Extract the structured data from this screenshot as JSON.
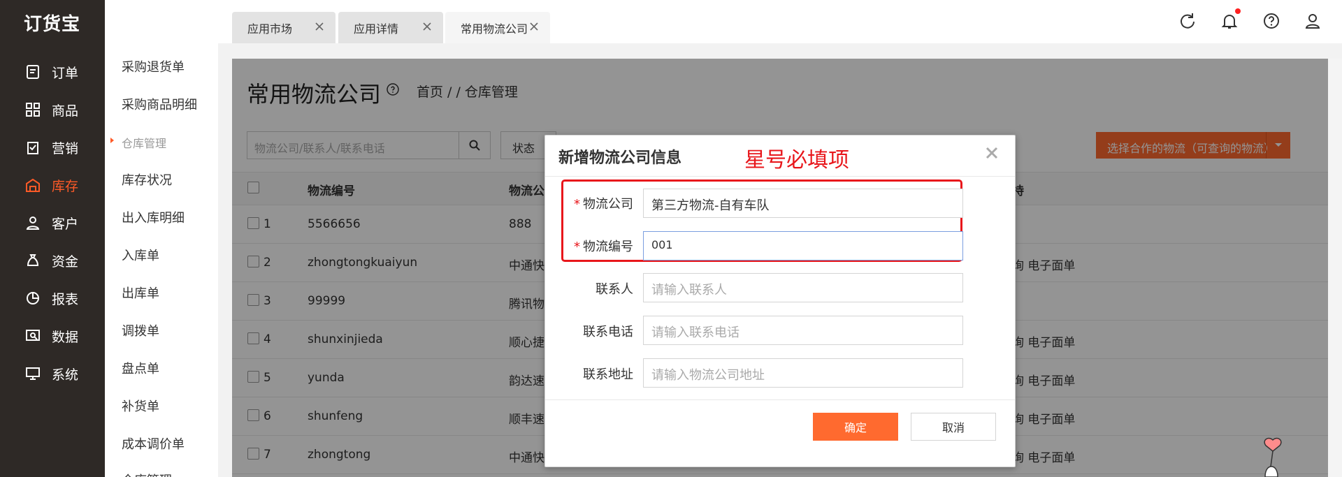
{
  "app": {
    "logo": "订货宝"
  },
  "sidebar": {
    "items": [
      {
        "label": "订单",
        "icon": "order-icon"
      },
      {
        "label": "商品",
        "icon": "goods-icon"
      },
      {
        "label": "营销",
        "icon": "marketing-icon"
      },
      {
        "label": "库存",
        "icon": "warehouse-icon",
        "active": true
      },
      {
        "label": "客户",
        "icon": "customer-icon"
      },
      {
        "label": "资金",
        "icon": "money-bag-icon"
      },
      {
        "label": "报表",
        "icon": "pie-chart-icon"
      },
      {
        "label": "数据",
        "icon": "data-analysis-icon"
      },
      {
        "label": "系统",
        "icon": "monitor-icon"
      }
    ]
  },
  "submenu": {
    "items": [
      "采购退货单",
      "采购商品明细",
      "仓库管理",
      "库存状况",
      "出入库明细",
      "入库单",
      "出库单",
      "调拨单",
      "盘点单",
      "补货单",
      "成本调价单",
      "仓库管理"
    ]
  },
  "tabs": [
    {
      "label": "应用市场"
    },
    {
      "label": "应用详情"
    },
    {
      "label": "常用物流公司",
      "active": true
    }
  ],
  "page": {
    "title": "常用物流公司",
    "breadcrumb": "首页 /  / 仓库管理",
    "search_placeholder": "物流公司/联系人/联系电话",
    "status_label": "状态",
    "partner_button": "选择合作的物流（可查询的物流）"
  },
  "table": {
    "headers": [
      "物流编号",
      "物流公",
      "持"
    ],
    "rows": [
      {
        "idx": "1",
        "code": "5566656",
        "company": "888",
        "support": ""
      },
      {
        "idx": "2",
        "code": "zhongtongkuaiyun",
        "company": "中通快",
        "support": "询 电子面单"
      },
      {
        "idx": "3",
        "code": "99999",
        "company": "腾讯物",
        "support": ""
      },
      {
        "idx": "4",
        "code": "shunxinjieda",
        "company": "顺心捷",
        "support": "询 电子面单"
      },
      {
        "idx": "5",
        "code": "yunda",
        "company": "韵达速",
        "support": "询 电子面单"
      },
      {
        "idx": "6",
        "code": "shunfeng",
        "company": "顺丰速",
        "support": "询 电子面单"
      },
      {
        "idx": "7",
        "code": "zhongtong",
        "company": "中通快",
        "support": "询 电子面单"
      }
    ]
  },
  "modal": {
    "title": "新增物流公司信息",
    "annotation": "星号必填项",
    "fields": [
      {
        "label": "物流公司",
        "required": true,
        "value": "第三方物流-自有车队",
        "placeholder": ""
      },
      {
        "label": "物流编号",
        "required": true,
        "value": "001",
        "placeholder": ""
      },
      {
        "label": "联系人",
        "required": false,
        "value": "",
        "placeholder": "请输入联系人"
      },
      {
        "label": "联系电话",
        "required": false,
        "value": "",
        "placeholder": "请输入联系电话"
      },
      {
        "label": "联系地址",
        "required": false,
        "value": "",
        "placeholder": "请输入物流公司地址"
      }
    ],
    "ok_label": "确定",
    "cancel_label": "取消"
  },
  "colors": {
    "accent": "#ff6a2f",
    "sidebar_bg": "#2e2926",
    "annotation_red": "#e8161b"
  }
}
